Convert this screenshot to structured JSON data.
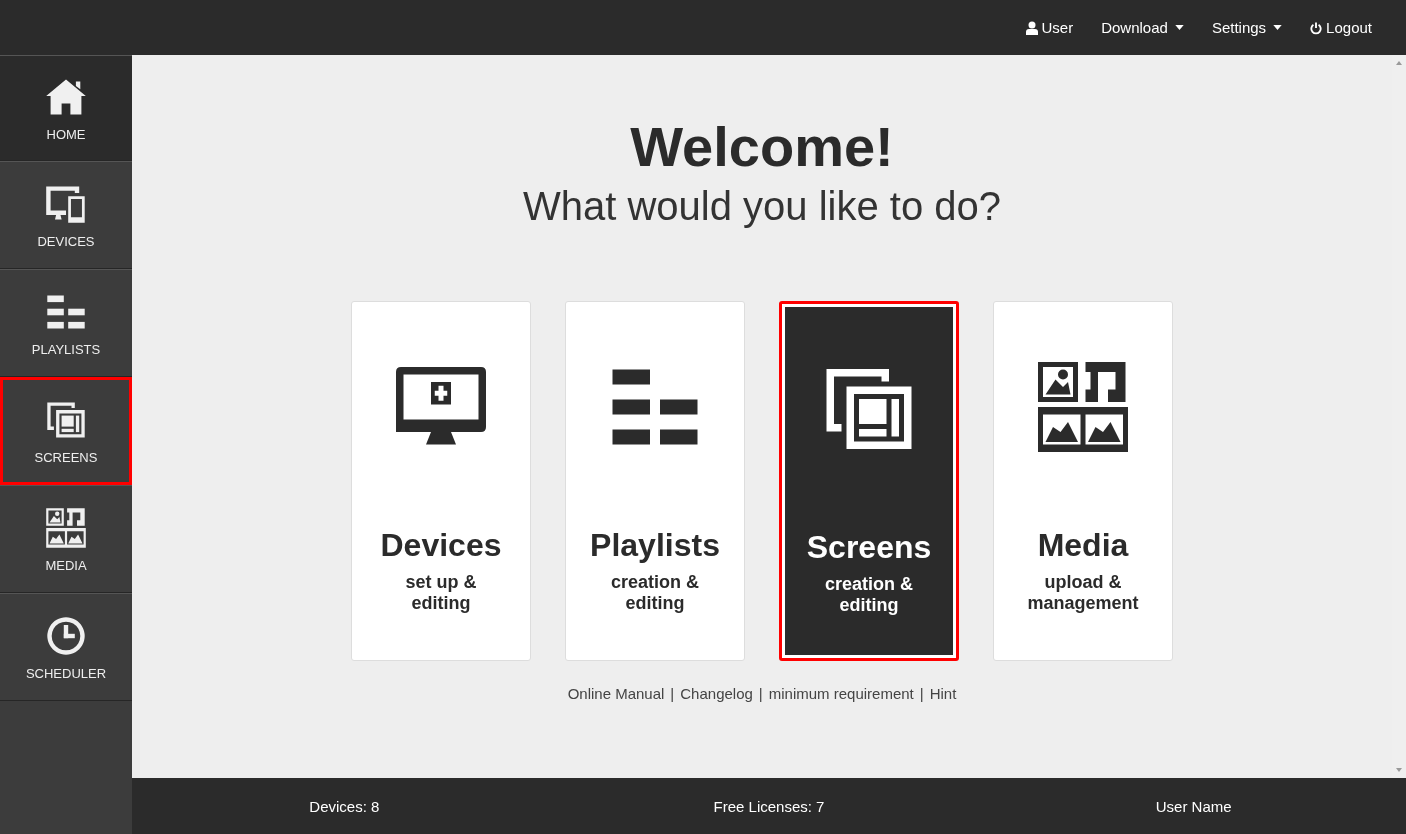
{
  "top_nav": [
    {
      "label": "User",
      "kind": "user",
      "dropdown": false
    },
    {
      "label": "Download",
      "kind": "menu",
      "dropdown": true
    },
    {
      "label": "Settings",
      "kind": "menu",
      "dropdown": true
    },
    {
      "label": "Logout",
      "kind": "power",
      "dropdown": false
    }
  ],
  "sidebar": {
    "items": [
      {
        "label": "HOME",
        "kind": "home",
        "selected": true,
        "highlighted": false
      },
      {
        "label": "DEVICES",
        "kind": "devices",
        "selected": false,
        "highlighted": false
      },
      {
        "label": "PLAYLISTS",
        "kind": "playlists",
        "selected": false,
        "highlighted": false
      },
      {
        "label": "SCREENS",
        "kind": "screens",
        "selected": false,
        "highlighted": true
      },
      {
        "label": "MEDIA",
        "kind": "media",
        "selected": false,
        "highlighted": false
      },
      {
        "label": "SCHEDULER",
        "kind": "scheduler",
        "selected": false,
        "highlighted": false
      }
    ]
  },
  "main": {
    "title": "Welcome!",
    "subtitle": "What would you like to do?",
    "cards": [
      {
        "title": "Devices",
        "subtitle": "set up & editing",
        "kind": "monitor-plus",
        "selected": false,
        "highlighted": false
      },
      {
        "title": "Playlists",
        "subtitle": "creation & editing",
        "kind": "playlists",
        "selected": false,
        "highlighted": false
      },
      {
        "title": "Screens",
        "subtitle": "creation & editing",
        "kind": "screens",
        "selected": true,
        "highlighted": true
      },
      {
        "title": "Media",
        "subtitle": "upload & management",
        "kind": "media",
        "selected": false,
        "highlighted": false
      }
    ],
    "links": [
      "Online Manual",
      "Changelog",
      "minimum requirement",
      "Hint"
    ],
    "link_separator": "|"
  },
  "status_bar": [
    "Devices: 8",
    "Free Licenses: 7",
    "User Name"
  ]
}
